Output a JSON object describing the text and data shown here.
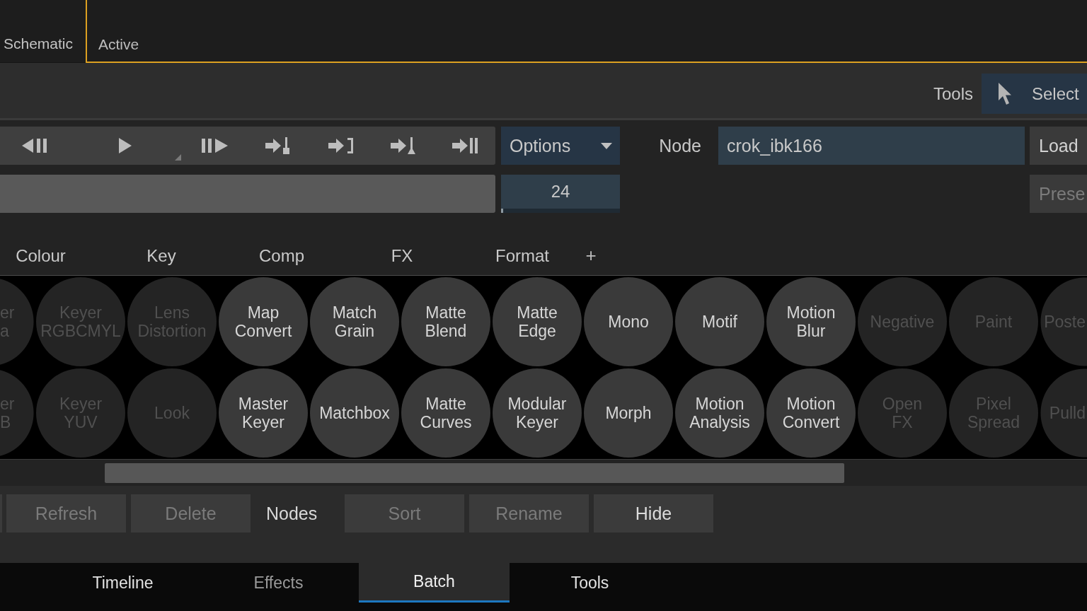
{
  "view_tabs": [
    {
      "label": "Schematic",
      "selected": false
    },
    {
      "label": "Active",
      "selected": true
    }
  ],
  "toolbar": {
    "label": "Tools",
    "select_button": "Select"
  },
  "transport": {
    "options": "Options",
    "frame_field": {
      "value": "24",
      "level": 0.02
    }
  },
  "node": {
    "label": "Node",
    "value": "crok_ibk166",
    "load_button": "Load",
    "preset_button": {
      "label": "Prese",
      "disabled": true
    }
  },
  "categories": [
    {
      "label": "Colour",
      "selected": false
    },
    {
      "label": "Key",
      "selected": false
    },
    {
      "label": "Comp",
      "selected": false
    },
    {
      "label": "FX",
      "selected": false
    },
    {
      "label": "Format",
      "selected": false
    }
  ],
  "add_category": "+",
  "node_grid": [
    [
      {
        "label": "er a",
        "disabled": true
      },
      {
        "label": "Keyer RGBCMYL",
        "disabled": true
      },
      {
        "label": "Lens Distortion",
        "disabled": true
      },
      {
        "label": "Map Convert",
        "disabled": false
      },
      {
        "label": "Match Grain",
        "disabled": false
      },
      {
        "label": "Matte Blend",
        "disabled": false
      },
      {
        "label": "Matte Edge",
        "disabled": false
      },
      {
        "label": "Mono",
        "disabled": false
      },
      {
        "label": "Motif",
        "disabled": false
      },
      {
        "label": "Motion Blur",
        "disabled": false
      },
      {
        "label": "Negative",
        "disabled": true
      },
      {
        "label": "Paint",
        "disabled": true
      },
      {
        "label": "Poste",
        "disabled": true
      }
    ],
    [
      {
        "label": "er B",
        "disabled": true
      },
      {
        "label": "Keyer YUV",
        "disabled": true
      },
      {
        "label": "Look",
        "disabled": true
      },
      {
        "label": "Master Keyer",
        "disabled": false
      },
      {
        "label": "Matchbox",
        "disabled": false
      },
      {
        "label": "Matte Curves",
        "disabled": false
      },
      {
        "label": "Modular Keyer",
        "disabled": false
      },
      {
        "label": "Morph",
        "disabled": false
      },
      {
        "label": "Motion Analysis",
        "disabled": false
      },
      {
        "label": "Motion Convert",
        "disabled": false
      },
      {
        "label": "Open FX",
        "disabled": true
      },
      {
        "label": "Pixel Spread",
        "disabled": true
      },
      {
        "label": "Pulld",
        "disabled": true
      }
    ]
  ],
  "actions": [
    {
      "kind": "button",
      "label": "Refresh",
      "disabled": true
    },
    {
      "kind": "button",
      "label": "Delete",
      "disabled": true
    },
    {
      "kind": "label",
      "label": "Nodes"
    },
    {
      "kind": "button",
      "label": "Sort",
      "disabled": true
    },
    {
      "kind": "button",
      "label": "Rename",
      "disabled": true
    },
    {
      "kind": "button",
      "label": "Hide",
      "disabled": false
    }
  ],
  "bottom_tabs": [
    {
      "label": "Timeline",
      "selected": false,
      "disabled": false
    },
    {
      "label": "Effects",
      "selected": false,
      "disabled": true
    },
    {
      "label": "Batch",
      "selected": true,
      "disabled": false
    },
    {
      "label": "Tools",
      "selected": false,
      "disabled": false
    }
  ]
}
